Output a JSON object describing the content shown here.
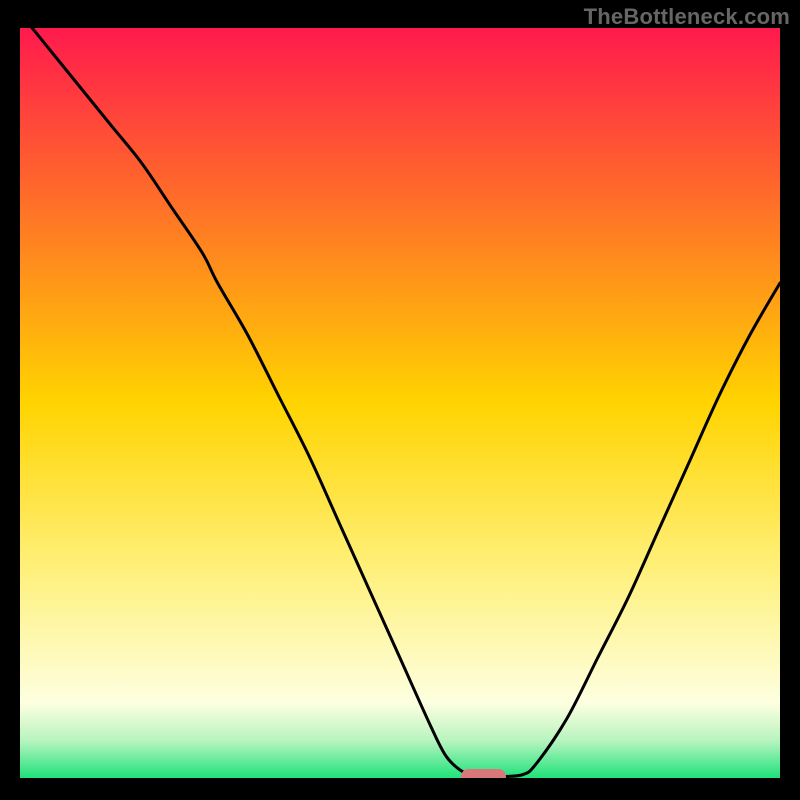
{
  "watermark": "TheBottleneck.com",
  "colors": {
    "bg_black": "#000000",
    "watermark_text": "#666666",
    "curve": "#000000",
    "marker": "#d9777b",
    "grad_top": "#ff1a4d",
    "grad_mid_upper": "#ff7a1f",
    "grad_mid": "#ffd400",
    "grad_mid_lower": "#fff59a",
    "grad_lower_pale": "#fdffe0",
    "grad_green_soft": "#b8f4c0",
    "grad_green": "#1ee27a"
  },
  "chart_data": {
    "type": "line",
    "title": "",
    "xlabel": "",
    "ylabel": "",
    "xlim": [
      0,
      100
    ],
    "ylim": [
      0,
      100
    ],
    "note": "Axis values are estimated from pixel positions (no tick labels in image). y=100 is the top of the gradient, y=0 the bottom green band.",
    "series": [
      {
        "name": "curve",
        "x": [
          0,
          4,
          8,
          12,
          16,
          20,
          24,
          26,
          30,
          34,
          38,
          42,
          46,
          50,
          54,
          56,
          58,
          60,
          62,
          66,
          68,
          72,
          76,
          80,
          84,
          88,
          92,
          96,
          100
        ],
        "y": [
          102,
          97,
          92,
          87,
          82,
          76,
          70,
          66,
          59,
          51,
          43,
          34,
          25,
          16,
          7,
          3,
          1,
          0.2,
          0.2,
          0.4,
          2,
          8,
          16,
          24,
          33,
          42,
          51,
          59,
          66
        ]
      }
    ],
    "marker": {
      "x_start": 58,
      "x_end": 64,
      "y": 0.3
    },
    "gradient_stops_pct_from_top": [
      {
        "pct": 0,
        "color": "#ff1a4d"
      },
      {
        "pct": 22,
        "color": "#ff6a2a"
      },
      {
        "pct": 50,
        "color": "#ffd400"
      },
      {
        "pct": 72,
        "color": "#fff07a"
      },
      {
        "pct": 90,
        "color": "#fdffe0"
      },
      {
        "pct": 95,
        "color": "#b8f4c0"
      },
      {
        "pct": 100,
        "color": "#1ee27a"
      }
    ]
  }
}
